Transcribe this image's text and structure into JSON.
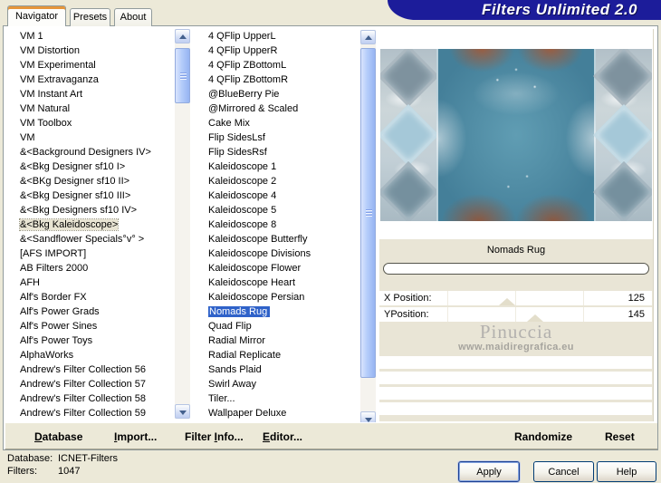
{
  "window": {
    "title": "Filters Unlimited 2.0"
  },
  "tabs": [
    {
      "label": "Navigator",
      "active": true
    },
    {
      "label": "Presets",
      "active": false
    },
    {
      "label": "About",
      "active": false
    }
  ],
  "category_list": {
    "selected_index": 13,
    "items": [
      "VM 1",
      "VM Distortion",
      "VM Experimental",
      "VM Extravaganza",
      "VM Instant Art",
      "VM Natural",
      "VM Toolbox",
      "VM",
      "&<Background Designers IV>",
      "&<Bkg Designer sf10 I>",
      "&<BKg Designer sf10 II>",
      "&<Bkg Designer sf10 III>",
      "&<Bkg Designers sf10 IV>",
      "&<Bkg Kaleidoscope>",
      "&<Sandflower Specials°v° >",
      "[AFS IMPORT]",
      "AB Filters 2000",
      "AFH",
      "Alf's Border FX",
      "Alf's Power Grads",
      "Alf's Power Sines",
      "Alf's Power Toys",
      "AlphaWorks",
      "Andrew's Filter Collection 56",
      "Andrew's Filter Collection 57",
      "Andrew's Filter Collection 58",
      "Andrew's Filter Collection 59"
    ]
  },
  "filter_list": {
    "selected_index": 19,
    "items": [
      "4 QFlip UpperL",
      "4 QFlip UpperR",
      "4 QFlip ZBottomL",
      "4 QFlip ZBottomR",
      "@BlueBerry Pie",
      "@Mirrored & Scaled",
      "Cake Mix",
      "Flip SidesLsf",
      "Flip SidesRsf",
      "Kaleidoscope 1",
      "Kaleidoscope 2",
      "Kaleidoscope 4",
      "Kaleidoscope 5",
      "Kaleidoscope 8",
      "Kaleidoscope Butterfly",
      "Kaleidoscope Divisions",
      "Kaleidoscope Flower",
      "Kaleidoscope Heart",
      "Kaleidoscope Persian",
      "Nomads Rug",
      "Quad Flip",
      "Radial Mirror",
      "Radial Replicate",
      "Sands Plaid",
      "Swirl Away",
      "Tiler...",
      "Wallpaper Deluxe"
    ]
  },
  "preview": {
    "filter_title": "Nomads Rug"
  },
  "params": [
    {
      "label": "X Position:",
      "value": "125",
      "thumb_pct": 47
    },
    {
      "label": "YPosition:",
      "value": "145",
      "thumb_pct": 57
    }
  ],
  "watermark": {
    "name": "Pinuccia",
    "url": "www.maidiregrafica.eu"
  },
  "toolbar": {
    "database": {
      "pre": "",
      "accel": "D",
      "post": "atabase"
    },
    "import": {
      "pre": "",
      "accel": "I",
      "post": "mport..."
    },
    "filter_info": {
      "pre": "Filter ",
      "accel": "I",
      "post": "nfo..."
    },
    "editor": {
      "pre": "",
      "accel": "E",
      "post": "ditor..."
    },
    "randomize": "Randomize",
    "reset": "Reset"
  },
  "status": {
    "database_label": "Database:",
    "database_value": "ICNET-Filters",
    "filters_label": "Filters:",
    "filters_value": "1047"
  },
  "buttons": {
    "apply": "Apply",
    "cancel": "Cancel",
    "help": "Help"
  },
  "colors": {
    "dialog_bg": "#ece9d8",
    "banner_blue": "#1c1c9a",
    "selection_blue": "#2f62c9",
    "tab_accent_orange": "#e5953a"
  }
}
